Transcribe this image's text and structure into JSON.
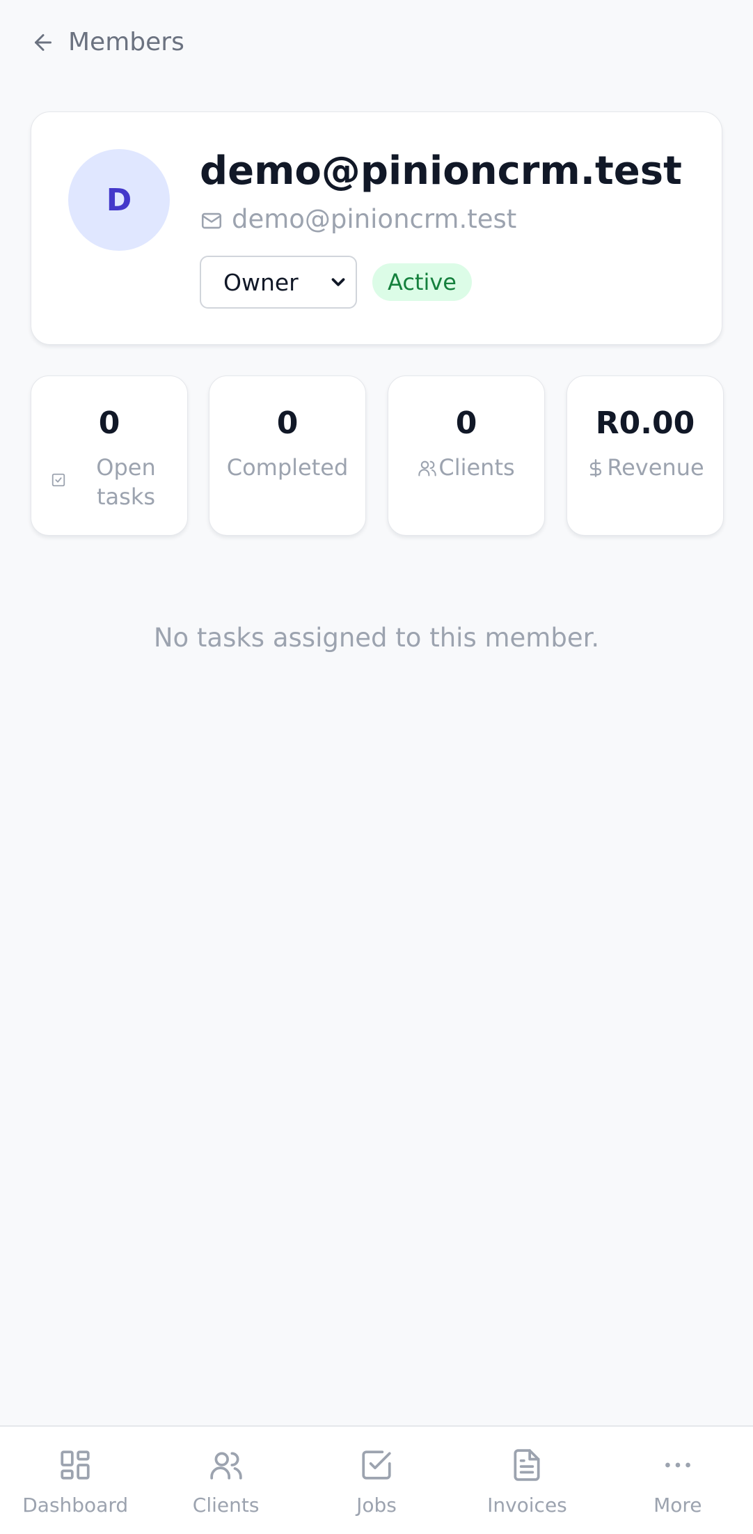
{
  "header": {
    "back_label": "Members"
  },
  "profile": {
    "avatar_initial": "D",
    "name": "demo@pinioncrm.test",
    "email": "demo@pinioncrm.test",
    "role_selected": "Owner",
    "status": "Active"
  },
  "stats": [
    {
      "value": "0",
      "label": "Open tasks",
      "icon": "check-square-icon"
    },
    {
      "value": "0",
      "label": "Completed",
      "icon": ""
    },
    {
      "value": "0",
      "label": "Clients",
      "icon": "users-icon"
    },
    {
      "value": "R0.00",
      "label": "Revenue",
      "icon": "dollar-icon"
    }
  ],
  "empty_message": "No tasks assigned to this member.",
  "bottom_nav": [
    {
      "label": "Dashboard",
      "icon": "dashboard-icon"
    },
    {
      "label": "Clients",
      "icon": "users-icon"
    },
    {
      "label": "Jobs",
      "icon": "check-square-icon"
    },
    {
      "label": "Invoices",
      "icon": "document-icon"
    },
    {
      "label": "More",
      "icon": "more-icon"
    }
  ],
  "colors": {
    "background": "#f8f9fb",
    "accent": "#4338ca",
    "avatar_bg": "#e0e7ff",
    "badge_bg": "#dcfce7",
    "badge_text": "#15803d",
    "muted_text": "#9ca3af"
  }
}
